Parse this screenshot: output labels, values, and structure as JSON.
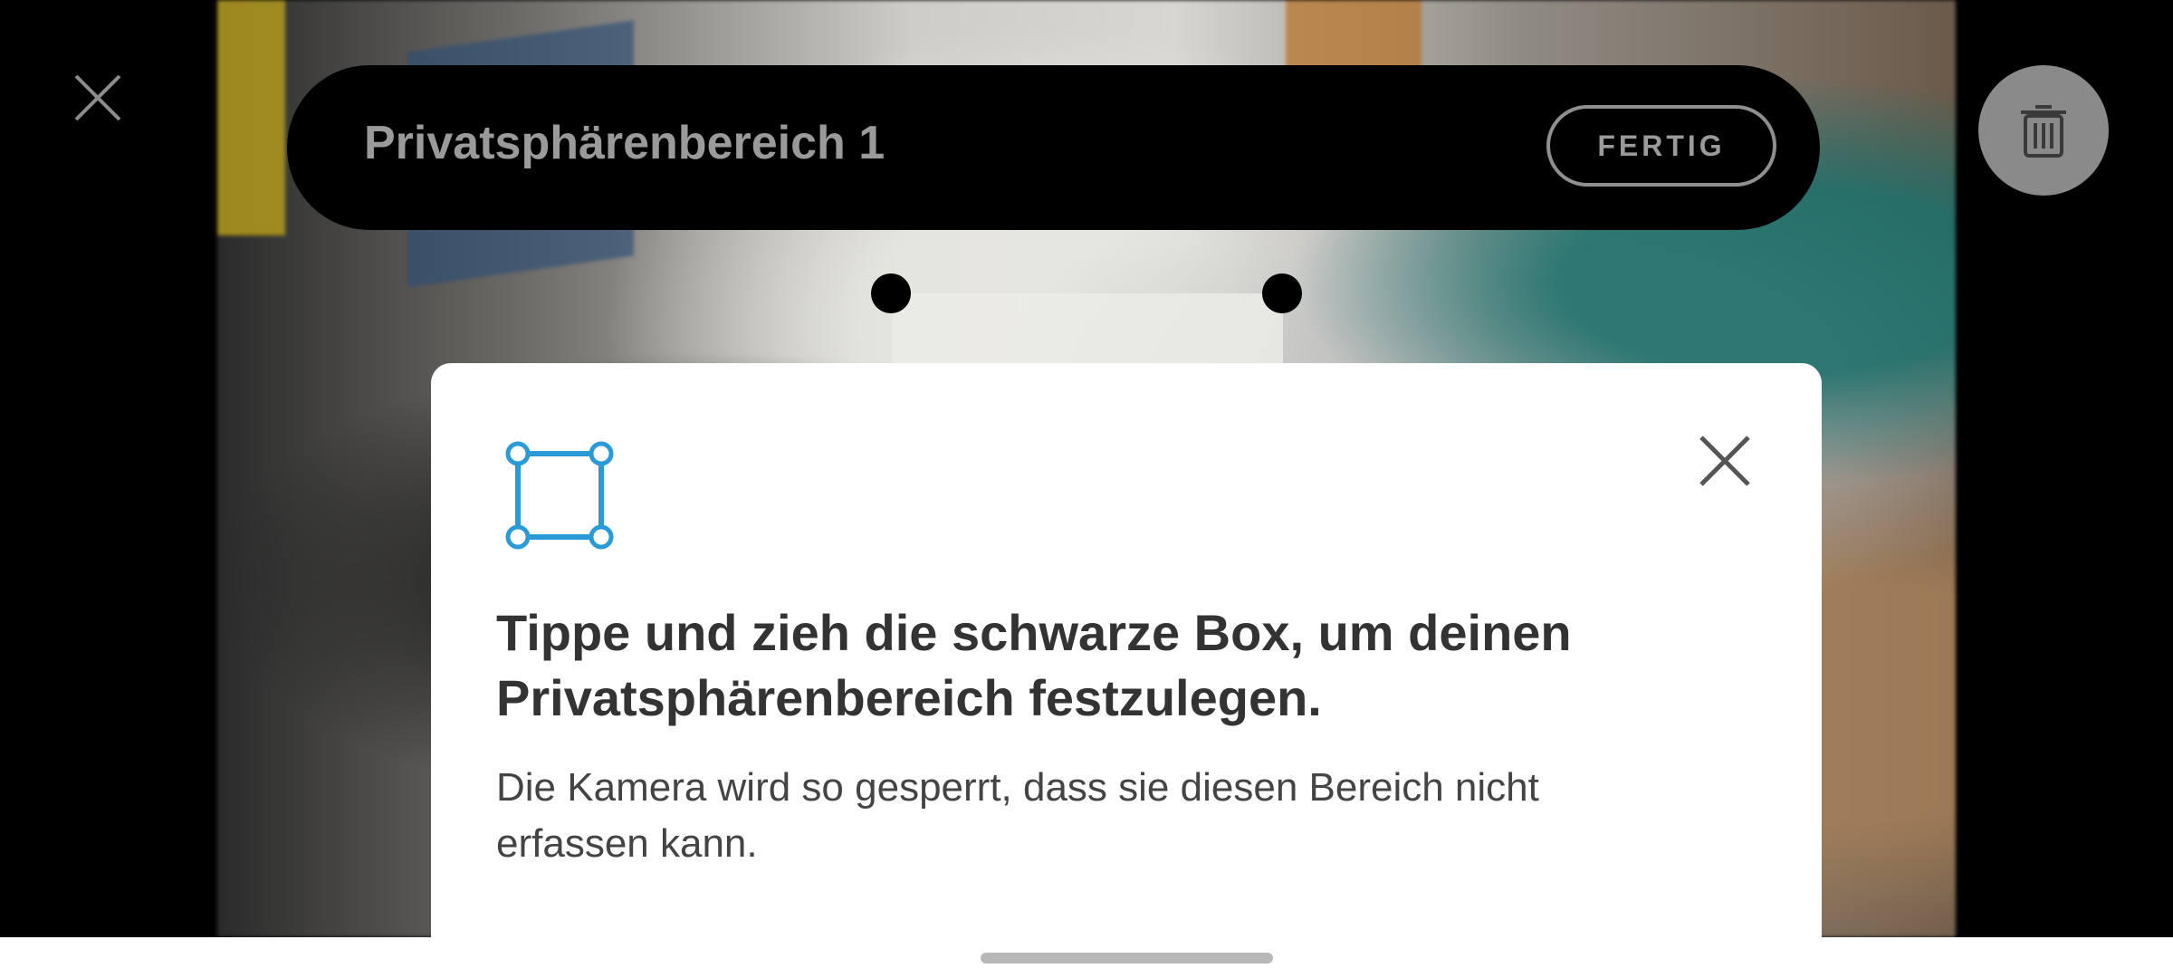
{
  "header": {
    "zone_title": "Privatsphärenbereich 1",
    "done_label": "FERTIG",
    "close_icon": "close-icon",
    "trash_icon": "trash-icon"
  },
  "sheet": {
    "icon": "privacy-zone-icon",
    "heading": "Tippe und zieh die schwarze Box, um deinen Privatsphärenbereich festzulegen.",
    "body": "Die Kamera wird so gesperrt, dass sie diesen Bereich nicht erfassen kann.",
    "close_icon": "close-icon"
  },
  "colors": {
    "accent": "#2a9bd6",
    "pill_text": "#9a9a9a",
    "trash_bg": "#8a8a8a"
  }
}
